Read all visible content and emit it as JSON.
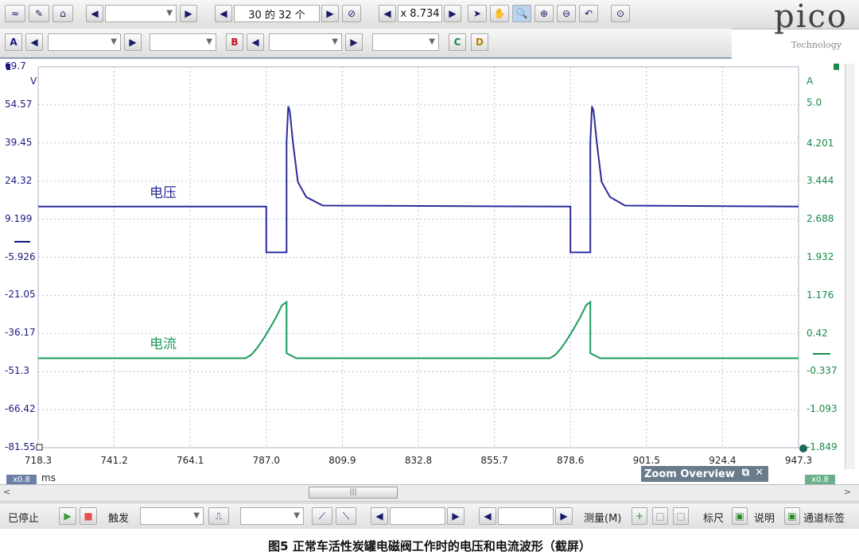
{
  "toolbar": {
    "capture_count": "30 的 32 个",
    "zoom_factor": "x 8.734",
    "brand": "pico",
    "brand_sub": "Technology",
    "channels": [
      "A",
      "B",
      "C",
      "D"
    ]
  },
  "signal_labels": {
    "voltage": "电压",
    "current": "电流"
  },
  "chart_data": {
    "type": "line",
    "x_unit": "ms",
    "x_ticks": [
      "718.3",
      "741.2",
      "764.1",
      "787.0",
      "809.9",
      "832.8",
      "855.7",
      "878.6",
      "901.5",
      "924.4",
      "947.3"
    ],
    "xlim": [
      718.3,
      947.3
    ],
    "left_axis": {
      "unit": "V",
      "ticks": [
        "69.7",
        "54.57",
        "39.45",
        "24.32",
        "9.199",
        "-5.926",
        "-21.05",
        "-36.17",
        "-51.3",
        "-66.42",
        "-81.55"
      ],
      "ylim": [
        -81.55,
        69.7
      ],
      "color": "#1a1a80"
    },
    "right_axis": {
      "unit": "A",
      "ticks": [
        "5.0",
        "4.201",
        "3.444",
        "2.688",
        "1.932",
        "1.176",
        "0.42",
        "-0.337",
        "-1.093",
        "-1.849"
      ],
      "color": "#1a8a4a"
    },
    "series": [
      {
        "name": "电压",
        "color": "#2b2b9a",
        "x": [
          718.3,
          787.0,
          787.0,
          793.1,
          793.1,
          793.6,
          794.1,
          795.0,
          796.5,
          799.0,
          804.0,
          878.6,
          878.6,
          884.6,
          884.6,
          885.1,
          885.6,
          886.5,
          888.0,
          890.5,
          895.0,
          947.3
        ],
        "y": [
          14.2,
          14.2,
          -4.0,
          -4.0,
          40.0,
          54.0,
          52.0,
          40.0,
          24.0,
          18.0,
          14.6,
          14.2,
          -4.0,
          -4.0,
          40.0,
          54.0,
          52.0,
          40.0,
          24.0,
          18.0,
          14.6,
          14.2
        ]
      },
      {
        "name": "电流",
        "color": "#1a9a5a",
        "x": [
          718.3,
          780.8,
          782.5,
          784.2,
          786.0,
          788.0,
          790.0,
          791.7,
          793.1,
          793.1,
          796.0,
          872.4,
          874.1,
          875.8,
          877.6,
          879.6,
          881.6,
          883.3,
          884.6,
          884.6,
          887.5,
          947.3
        ],
        "y": [
          -0.07,
          -0.07,
          0.0,
          0.13,
          0.3,
          0.52,
          0.75,
          0.98,
          1.05,
          0.03,
          -0.07,
          -0.07,
          0.0,
          0.13,
          0.3,
          0.52,
          0.75,
          0.98,
          1.05,
          0.03,
          -0.07,
          -0.07
        ]
      }
    ]
  },
  "bottom_left": {
    "scale": "x0.8",
    "unit": "ms"
  },
  "zoom_overview": "Zoom Overview",
  "status_bar": {
    "stop": "已停止",
    "trigger": "触发",
    "measure": "测量(M)",
    "ruler": "标尺",
    "notes": "说明",
    "channel_labels": "通道标签"
  },
  "right_scale": "x0.8",
  "caption": "图5   正常车活性炭罐电磁阀工作时的电压和电流波形（截屏）"
}
